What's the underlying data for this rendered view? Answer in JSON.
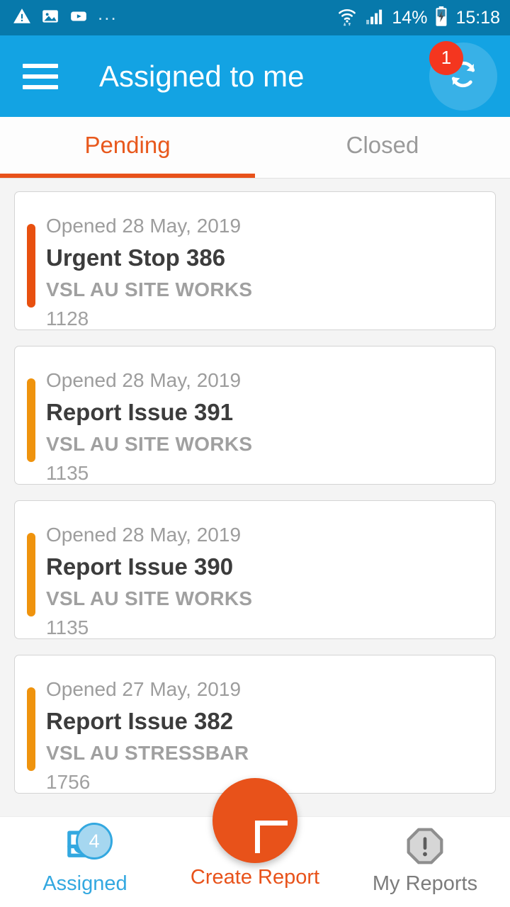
{
  "status_bar": {
    "left_icons": [
      "warning-triangle-icon",
      "image-icon",
      "youtube-icon"
    ],
    "overflow": "...",
    "right_icons": [
      "wifi-icon",
      "cellular-signal-icon",
      "battery-charging-icon"
    ],
    "battery_percent": "14%",
    "time": "15:18"
  },
  "app_bar": {
    "menu_icon": "hamburger-menu-icon",
    "title": "Assigned to me",
    "sync_icon": "sync-refresh-icon",
    "sync_badge": "1"
  },
  "tabs": [
    {
      "label": "Pending",
      "active": true
    },
    {
      "label": "Closed",
      "active": false
    }
  ],
  "cards": [
    {
      "date": "Opened 28 May, 2019",
      "title": "Urgent Stop 386",
      "org": "VSL AU SITE WORKS",
      "ref": "1128",
      "stripe_color": "#e8500f"
    },
    {
      "date": "Opened 28 May, 2019",
      "title": "Report Issue 391",
      "org": "VSL AU SITE WORKS",
      "ref": "1135",
      "stripe_color": "#ef930d"
    },
    {
      "date": "Opened 28 May, 2019",
      "title": "Report Issue 390",
      "org": "VSL AU SITE WORKS",
      "ref": "1135",
      "stripe_color": "#ef930d"
    },
    {
      "date": "Opened 27 May, 2019",
      "title": "Report Issue 382",
      "org": "VSL AU STRESSBAR",
      "ref": "1756",
      "stripe_color": "#ef930d"
    }
  ],
  "bottom_nav": {
    "assigned": {
      "label": "Assigned",
      "icon": "inbox-tray-icon",
      "badge": "4"
    },
    "create": {
      "label": "Create Report",
      "icon": "plus-icon"
    },
    "reports": {
      "label": "My Reports",
      "icon": "octagon-exclamation-icon"
    }
  },
  "colors": {
    "status_bar": "#0779ab",
    "app_bar": "#13a3e3",
    "accent_orange": "#e8521a",
    "accent_amber": "#ef930d",
    "badge_red": "#f4361f",
    "assigned_blue": "#33a8e0",
    "page_background": "#f4f4f4"
  }
}
